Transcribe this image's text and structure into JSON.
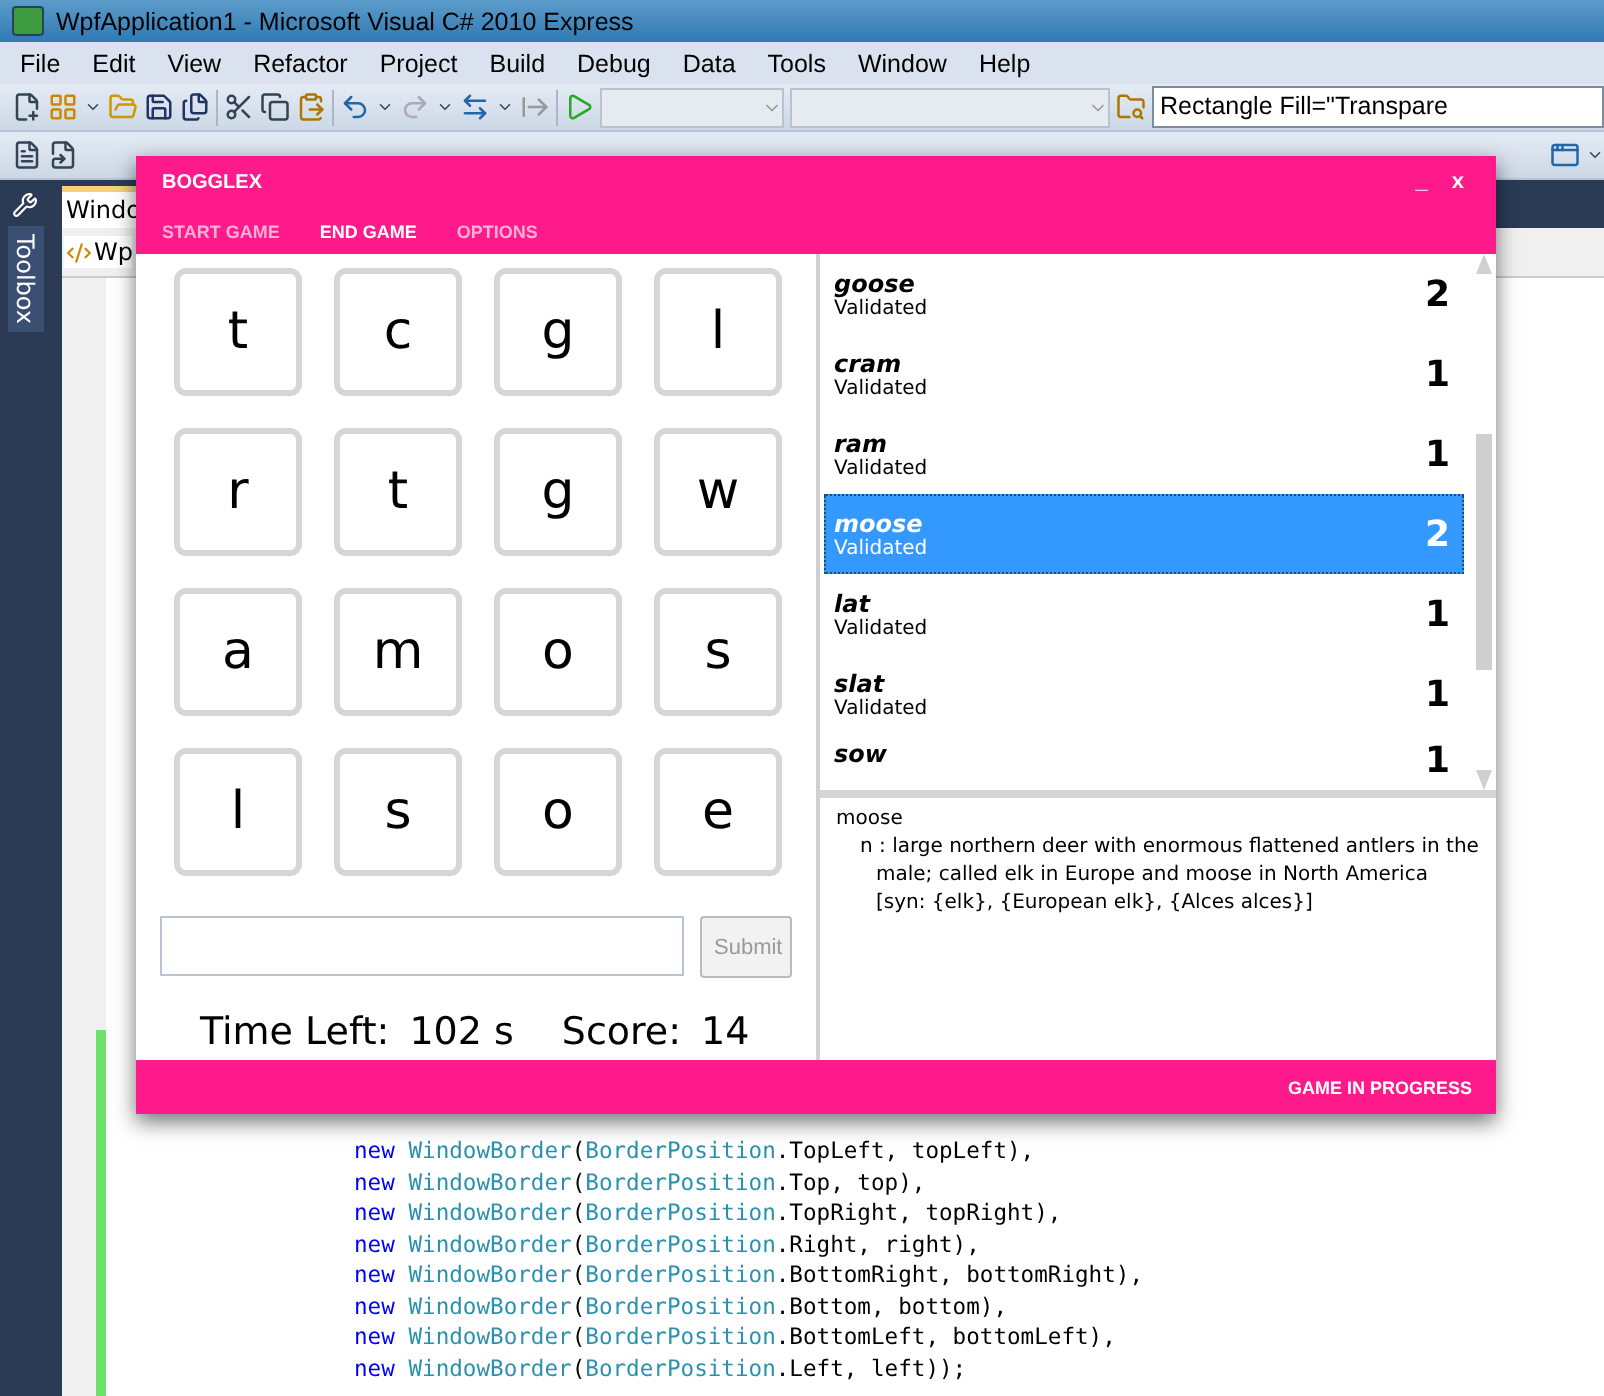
{
  "ide": {
    "title": "WpfApplication1 - Microsoft Visual C# 2010 Express",
    "menu": [
      "File",
      "Edit",
      "View",
      "Refactor",
      "Project",
      "Build",
      "Debug",
      "Data",
      "Tools",
      "Window",
      "Help"
    ],
    "toolbar_field": "Rectangle Fill=\"Transpare",
    "toolbox_label": "Toolbox",
    "document_tab": "Windo",
    "type_selector": "Wp",
    "code_lines": [
      [
        {
          "kind": "keyword",
          "text": "new "
        },
        {
          "kind": "type",
          "text": "WindowBorder"
        },
        {
          "kind": "plain",
          "text": "("
        },
        {
          "kind": "type",
          "text": "BorderPosition"
        },
        {
          "kind": "plain",
          "text": ".TopLeft, topLeft),"
        }
      ],
      [
        {
          "kind": "keyword",
          "text": "new "
        },
        {
          "kind": "type",
          "text": "WindowBorder"
        },
        {
          "kind": "plain",
          "text": "("
        },
        {
          "kind": "type",
          "text": "BorderPosition"
        },
        {
          "kind": "plain",
          "text": ".Top, top),"
        }
      ],
      [
        {
          "kind": "keyword",
          "text": "new "
        },
        {
          "kind": "type",
          "text": "WindowBorder"
        },
        {
          "kind": "plain",
          "text": "("
        },
        {
          "kind": "type",
          "text": "BorderPosition"
        },
        {
          "kind": "plain",
          "text": ".TopRight, topRight),"
        }
      ],
      [
        {
          "kind": "keyword",
          "text": "new "
        },
        {
          "kind": "type",
          "text": "WindowBorder"
        },
        {
          "kind": "plain",
          "text": "("
        },
        {
          "kind": "type",
          "text": "BorderPosition"
        },
        {
          "kind": "plain",
          "text": ".Right, right),"
        }
      ],
      [
        {
          "kind": "keyword",
          "text": "new "
        },
        {
          "kind": "type",
          "text": "WindowBorder"
        },
        {
          "kind": "plain",
          "text": "("
        },
        {
          "kind": "type",
          "text": "BorderPosition"
        },
        {
          "kind": "plain",
          "text": ".BottomRight, bottomRight),"
        }
      ],
      [
        {
          "kind": "keyword",
          "text": "new "
        },
        {
          "kind": "type",
          "text": "WindowBorder"
        },
        {
          "kind": "plain",
          "text": "("
        },
        {
          "kind": "type",
          "text": "BorderPosition"
        },
        {
          "kind": "plain",
          "text": ".Bottom, bottom),"
        }
      ],
      [
        {
          "kind": "keyword",
          "text": "new "
        },
        {
          "kind": "type",
          "text": "WindowBorder"
        },
        {
          "kind": "plain",
          "text": "("
        },
        {
          "kind": "type",
          "text": "BorderPosition"
        },
        {
          "kind": "plain",
          "text": ".BottomLeft, bottomLeft),"
        }
      ],
      [
        {
          "kind": "keyword",
          "text": "new "
        },
        {
          "kind": "type",
          "text": "WindowBorder"
        },
        {
          "kind": "plain",
          "text": "("
        },
        {
          "kind": "type",
          "text": "BorderPosition"
        },
        {
          "kind": "plain",
          "text": ".Left, left));"
        }
      ]
    ]
  },
  "game": {
    "title": "BOGGLEX",
    "minimize": "_",
    "close": "x",
    "menu": [
      {
        "label": "START GAME",
        "enabled": false
      },
      {
        "label": "END GAME",
        "enabled": true
      },
      {
        "label": "OPTIONS",
        "enabled": false
      }
    ],
    "tiles": [
      "t",
      "c",
      "g",
      "l",
      "r",
      "t",
      "g",
      "w",
      "a",
      "m",
      "o",
      "s",
      "l",
      "s",
      "o",
      "e"
    ],
    "submit": {
      "label": "Submit",
      "disabled": true
    },
    "time_label": "Time Left:",
    "time_value": "102 s",
    "score_label": "Score:",
    "score_value": "14",
    "words": [
      {
        "word": "goose",
        "status": "Validated",
        "points": "2",
        "selected": false
      },
      {
        "word": "cram",
        "status": "Validated",
        "points": "1",
        "selected": false
      },
      {
        "word": "ram",
        "status": "Validated",
        "points": "1",
        "selected": false
      },
      {
        "word": "moose",
        "status": "Validated",
        "points": "2",
        "selected": true
      },
      {
        "word": "lat",
        "status": "Validated",
        "points": "1",
        "selected": false
      },
      {
        "word": "slat",
        "status": "Validated",
        "points": "1",
        "selected": false
      },
      {
        "word": "sow",
        "points": "1",
        "selected": false
      }
    ],
    "definition": {
      "word": "moose",
      "sense": "n : large northern deer with enormous flattened antlers in the male; called elk in Europe and moose in North America",
      "synonyms": "[syn: {elk}, {European elk}, {Alces alces}]"
    },
    "status": "GAME IN PROGRESS"
  }
}
